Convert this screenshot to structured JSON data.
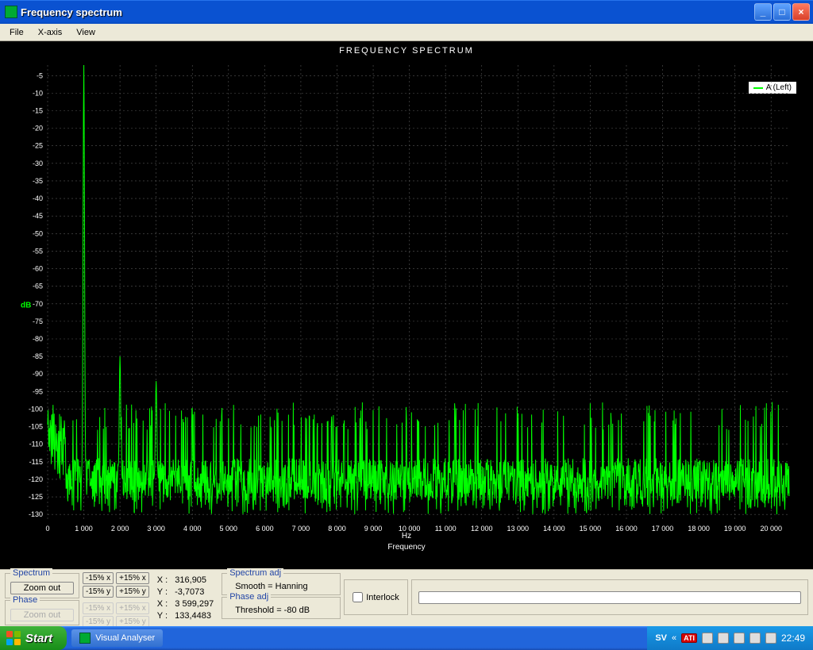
{
  "window": {
    "title": "Frequency spectrum"
  },
  "menu": {
    "file": "File",
    "xaxis": "X-axis",
    "view": "View"
  },
  "chart": {
    "title": "FREQUENCY SPECTRUM",
    "ylabel": "dB",
    "xunit": "Hz",
    "xlabel": "Frequency",
    "legend": "A (Left)"
  },
  "controls": {
    "spectrum_title": "Spectrum",
    "phase_title": "Phase",
    "zoom_out": "Zoom out",
    "m15x": "-15% x",
    "p15x": "+15% x",
    "m15y": "-15% y",
    "p15y": "+15% y",
    "spec_x_label": "X :",
    "spec_x": "316,905",
    "spec_y_label": "Y :",
    "spec_y": "-3,7073",
    "phase_x_label": "X :",
    "phase_x": "3 599,297",
    "phase_y_label": "Y :",
    "phase_y": "133,4483",
    "spectrum_adj_title": "Spectrum adj",
    "smooth": "Smooth = Hanning",
    "phase_adj_title": "Phase adj",
    "threshold": "Threshold = -80 dB",
    "interlock": "Interlock"
  },
  "taskbar": {
    "start": "Start",
    "task1": "Visual Analyser",
    "sv": "SV",
    "ati": "ATI",
    "clock": "22:49"
  },
  "chart_data": {
    "type": "line",
    "title": "FREQUENCY SPECTRUM",
    "xlabel": "Frequency",
    "xunit": "Hz",
    "ylabel": "dB",
    "xlim": [
      0,
      20500
    ],
    "ylim": [
      -132,
      -2
    ],
    "xticks": [
      0,
      1000,
      2000,
      3000,
      4000,
      5000,
      6000,
      7000,
      8000,
      9000,
      10000,
      11000,
      12000,
      13000,
      14000,
      15000,
      16000,
      17000,
      18000,
      19000,
      20000
    ],
    "xtick_labels": [
      "0",
      "1 000",
      "2 000",
      "3 000",
      "4 000",
      "5 000",
      "6 000",
      "7 000",
      "8 000",
      "9 000",
      "10 000",
      "11 000",
      "12 000",
      "13 000",
      "14 000",
      "15 000",
      "16 000",
      "17 000",
      "18 000",
      "19 000",
      "20 000"
    ],
    "yticks": [
      -5,
      -10,
      -15,
      -20,
      -25,
      -30,
      -35,
      -40,
      -45,
      -50,
      -55,
      -60,
      -65,
      -70,
      -75,
      -80,
      -85,
      -90,
      -95,
      -100,
      -105,
      -110,
      -115,
      -120,
      -125,
      -130
    ],
    "series": [
      {
        "name": "A (Left)",
        "color": "#00ff00",
        "peaks": [
          {
            "x": 1000,
            "y": -2
          },
          {
            "x": 2000,
            "y": -85
          },
          {
            "x": 3000,
            "y": -92
          }
        ],
        "noise_floor_mean": -120,
        "noise_peak_range": [
          -130,
          -98
        ],
        "noise_floor_comment": "Dense noise between roughly -130 and -98 dB across the full band, with a dominant fundamental peak at ~1 kHz reaching ~-2 dB and weak harmonics."
      }
    ]
  }
}
